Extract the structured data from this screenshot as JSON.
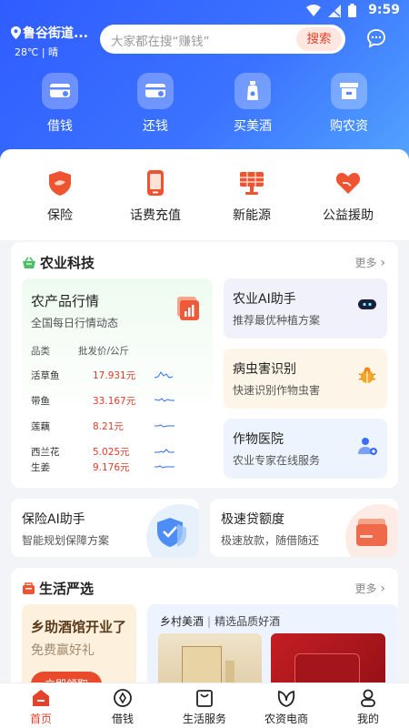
{
  "status": {
    "time": "9:59"
  },
  "header": {
    "location": "鲁谷街道...",
    "weather": "28℃ | 晴",
    "search_placeholder": "大家都在搜“赚钱”",
    "search_button": "搜索"
  },
  "topnav": [
    {
      "label": "借钱",
      "icon": "card-icon"
    },
    {
      "label": "还钱",
      "icon": "card-return-icon"
    },
    {
      "label": "买美酒",
      "icon": "bottle-icon"
    },
    {
      "label": "购农资",
      "icon": "shop-icon"
    }
  ],
  "services": [
    {
      "label": "保险",
      "icon": "insurance-shield-icon"
    },
    {
      "label": "话费充值",
      "icon": "phone-icon"
    },
    {
      "label": "新能源",
      "icon": "solar-panel-icon"
    },
    {
      "label": "公益援助",
      "icon": "heart-hand-icon"
    }
  ],
  "agri": {
    "title": "农业科技",
    "more": "更多",
    "market": {
      "title": "农产品行情",
      "subtitle": "全国每日行情动态",
      "col_name": "品类",
      "col_price": "批发价/公斤",
      "rows": [
        {
          "name": "活草鱼",
          "price": "17.931元"
        },
        {
          "name": "带鱼",
          "price": "33.167元"
        },
        {
          "name": "莲藕",
          "price": "8.21元"
        },
        {
          "name": "西兰花",
          "price": "5.025元"
        },
        {
          "name": "生姜",
          "price": "9.176元"
        }
      ]
    },
    "cards": [
      {
        "title": "农业AI助手",
        "subtitle": "推荐最优种植方案",
        "icon": "robot-icon",
        "bg": "#f0f1fb"
      },
      {
        "title": "病虫害识别",
        "subtitle": "快速识别作物虫害",
        "icon": "bug-icon",
        "bg": "#fdf6e8"
      },
      {
        "title": "作物医院",
        "subtitle": "农业专家在线服务",
        "icon": "doctor-icon",
        "bg": "#edf4fd"
      }
    ]
  },
  "promos": {
    "insurance": {
      "title": "保险AI助手",
      "subtitle": "智能规划保障方案"
    },
    "loan": {
      "title": "极速贷额度",
      "subtitle": "极速放款，随借随还"
    }
  },
  "life": {
    "title": "生活严选",
    "more": "更多",
    "promo": {
      "title": "乡助酒馆开业了",
      "subtitle": "免费赢好礼",
      "button": "立即领取"
    },
    "wine": {
      "title": "乡村美酒",
      "sep": "|",
      "subtitle": "精选品质好酒"
    }
  },
  "tabs": [
    {
      "label": "首页",
      "active": true
    },
    {
      "label": "借钱"
    },
    {
      "label": "生活服务"
    },
    {
      "label": "农资电商"
    },
    {
      "label": "我的"
    }
  ],
  "colors": {
    "brand_blue": "#3b6dff",
    "accent_red": "#e5422b",
    "price_red": "#e23b2a"
  }
}
